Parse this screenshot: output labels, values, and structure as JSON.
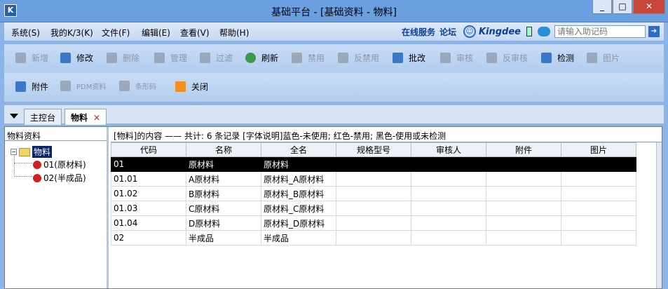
{
  "window": {
    "title": "基础平台 - [基础资料 - 物料]",
    "app_icon": "K",
    "btn_min": "_",
    "btn_max": "□",
    "btn_close": "✕"
  },
  "menu": {
    "items": [
      "系统(S)",
      "我的K/3(K)",
      "文件(F)",
      "编辑(E)",
      "查看(V)",
      "帮助(H)"
    ],
    "online_service": "在线服务",
    "forum": "论坛",
    "brand": "Kingdee",
    "help_placeholder": "请输入助记码"
  },
  "toolbar1": [
    {
      "label": "新增",
      "icon": "add-icon",
      "enabled": false
    },
    {
      "label": "修改",
      "icon": "edit-icon",
      "enabled": true
    },
    {
      "label": "删除",
      "icon": "delete-icon",
      "enabled": false
    },
    {
      "label": "管理",
      "icon": "tools-icon",
      "enabled": false
    },
    {
      "label": "过滤",
      "icon": "filter-icon",
      "enabled": false
    },
    {
      "label": "刷新",
      "icon": "refresh-icon",
      "enabled": true
    },
    {
      "label": "禁用",
      "icon": "disable-icon",
      "enabled": false
    },
    {
      "label": "反禁用",
      "icon": "enable-icon",
      "enabled": false
    },
    {
      "label": "批改",
      "icon": "batch-edit-icon",
      "enabled": true
    },
    {
      "label": "审核",
      "icon": "audit-icon",
      "enabled": false
    },
    {
      "label": "反审核",
      "icon": "unaudit-icon",
      "enabled": false
    },
    {
      "label": "检测",
      "icon": "check-icon",
      "enabled": true
    },
    {
      "label": "图片",
      "icon": "image-icon",
      "enabled": false
    }
  ],
  "toolbar2": [
    {
      "label": "附件",
      "icon": "attachment-icon",
      "enabled": true
    },
    {
      "label": "PDM资料",
      "icon": "pdm-icon",
      "enabled": false
    },
    {
      "label": "条形码",
      "icon": "barcode-icon",
      "enabled": false
    },
    {
      "label": "关闭",
      "icon": "close-window-icon",
      "enabled": true
    }
  ],
  "tabs": [
    {
      "label": "主控台",
      "active": false
    },
    {
      "label": "物料",
      "active": true,
      "close": "✕"
    }
  ],
  "tree": {
    "title": "物料资料",
    "root": "物料",
    "expander": "−",
    "children": [
      "01(原材料)",
      "02(半成品)"
    ]
  },
  "info_bar": "[物料]的内容 —— 共计: 6 条记录  [字体说明]蓝色-未使用; 红色-禁用; 黑色-使用或未检测",
  "grid": {
    "columns": [
      "代码",
      "名称",
      "全名",
      "规格型号",
      "审核人",
      "附件",
      "图片"
    ],
    "rows": [
      [
        "01",
        "原材料",
        "原材料",
        "",
        "",
        "",
        ""
      ],
      [
        "01.01",
        "A原材料",
        "原材料_A原材料",
        "",
        "",
        "",
        ""
      ],
      [
        "01.02",
        "B原材料",
        "原材料_B原材料",
        "",
        "",
        "",
        ""
      ],
      [
        "01.03",
        "C原材料",
        "原材料_C原材料",
        "",
        "",
        "",
        ""
      ],
      [
        "01.04",
        "D原材料",
        "原材料_D原材料",
        "",
        "",
        "",
        ""
      ],
      [
        "02",
        "半成品",
        "半成品",
        "",
        "",
        "",
        ""
      ]
    ],
    "selected_row": 0
  }
}
